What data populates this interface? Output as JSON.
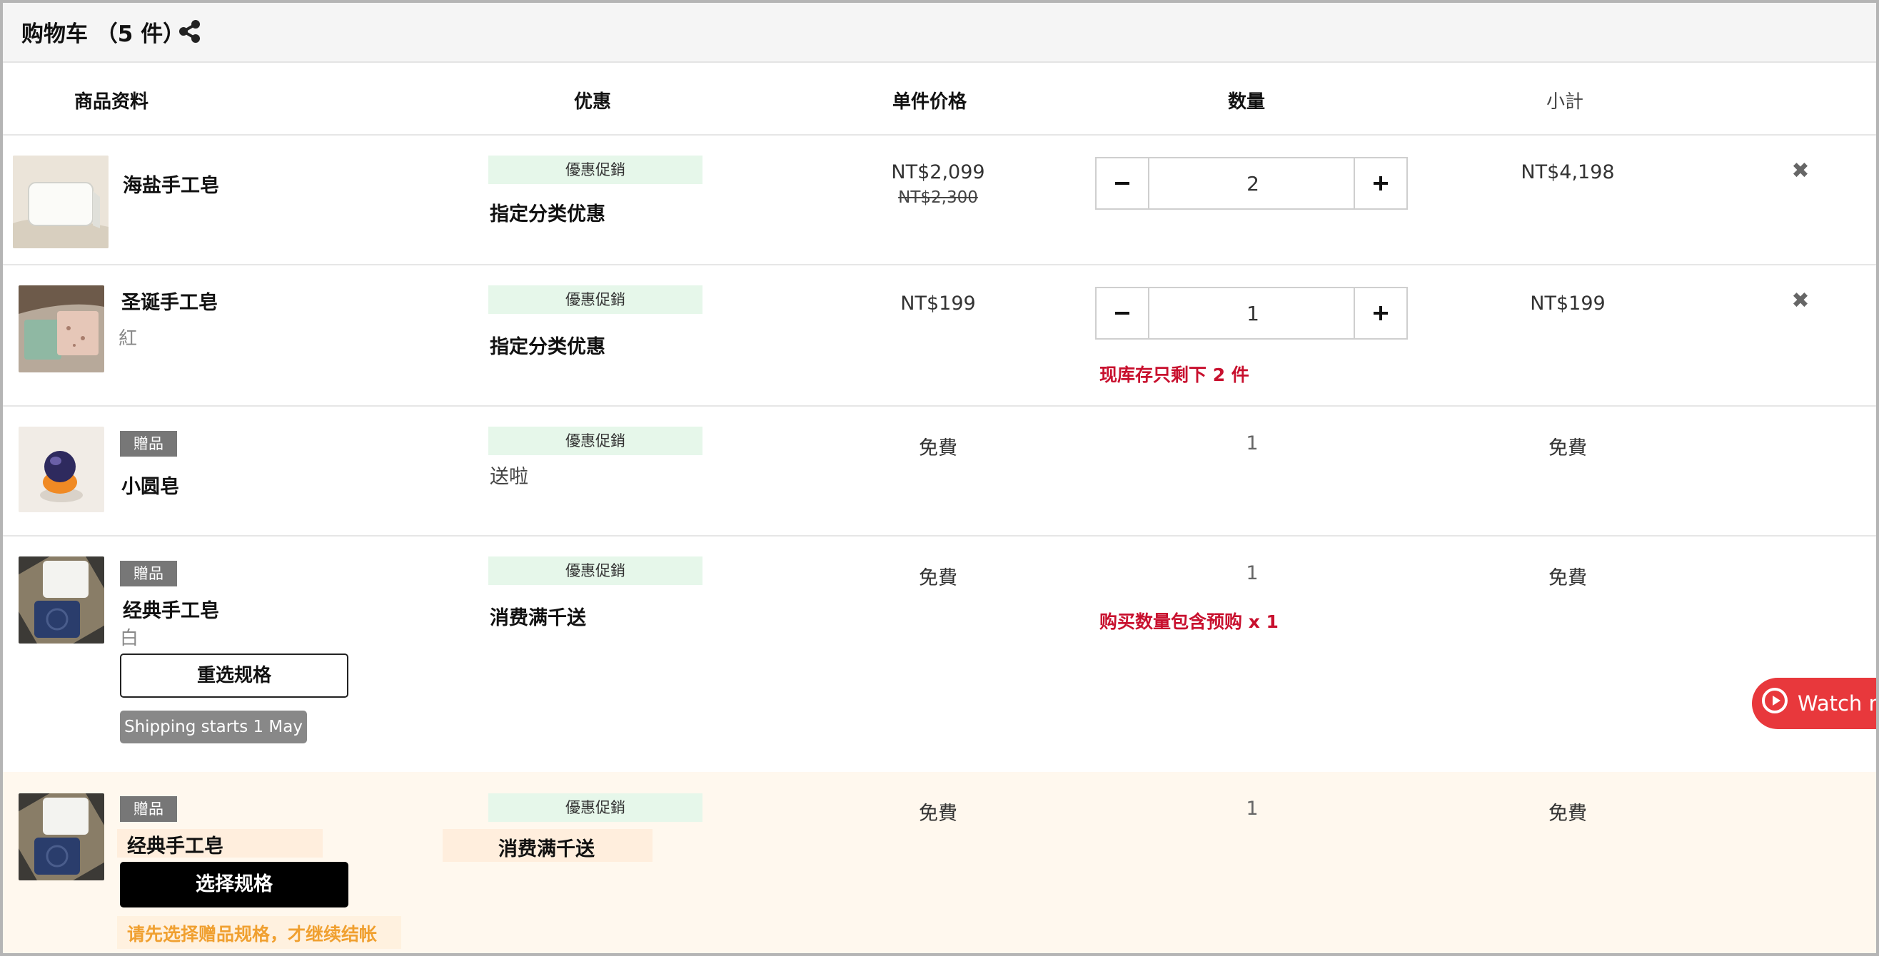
{
  "cart": {
    "title": "购物车 （5 件）"
  },
  "columns": {
    "product": "商品资料",
    "promotion": "优惠",
    "unit_price": "单件价格",
    "quantity": "数量",
    "subtotal": "小計"
  },
  "items": [
    {
      "name": "海盐手工皂",
      "promo_badge": "優惠促銷",
      "promo_name": "指定分类优惠",
      "price": "NT$2,099",
      "original_price": "NT$2,300",
      "quantity": "2",
      "subtotal": "NT$4,198"
    },
    {
      "name": "圣诞手工皂",
      "variant": "紅",
      "promo_badge": "優惠促銷",
      "promo_name": "指定分类优惠",
      "price": "NT$199",
      "quantity": "1",
      "stock_warning": "现库存只剩下 2 件",
      "subtotal": "NT$199"
    },
    {
      "gift_badge": "贈品",
      "name": "小圆皂",
      "promo_badge": "優惠促銷",
      "promo_name": "送啦",
      "price": "免費",
      "quantity": "1",
      "subtotal": "免費"
    },
    {
      "gift_badge": "贈品",
      "name": "经典手工皂",
      "variant": "白",
      "reselect_label": "重选规格",
      "shipping_badge": "Shipping starts 1 May",
      "promo_badge": "優惠促銷",
      "promo_name": "消费满千送",
      "price": "免費",
      "quantity": "1",
      "preorder_note": "购买数量包含预购 x 1",
      "subtotal": "免費"
    },
    {
      "gift_badge": "贈品",
      "name": "经典手工皂",
      "select_label": "选择规格",
      "gift_warning": "请先选择赠品规格，才继续结帐",
      "promo_badge": "優惠促銷",
      "promo_name": "消费满千送",
      "price": "免費",
      "quantity": "1",
      "subtotal": "免費"
    }
  ],
  "live": {
    "watch_label": "Watch re"
  },
  "colors": {
    "promo_badge_bg": "#e6f7ea",
    "warning_red": "#c8102e",
    "gift_warning_orange": "#f0a030",
    "watch_button": "#e8383c",
    "highlight_row": "#fff8ee"
  }
}
